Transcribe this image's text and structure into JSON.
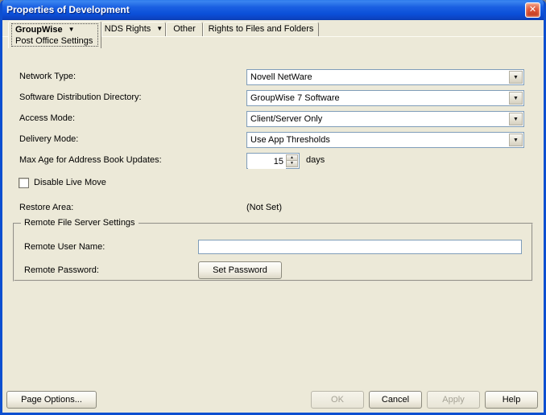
{
  "window": {
    "title": "Properties of Development"
  },
  "icons": {
    "close": "✕",
    "dropdown": "▼",
    "spin_up": "▲",
    "spin_down": "▼"
  },
  "tabs": [
    {
      "label": "GroupWise",
      "sublabel": "Post Office Settings"
    },
    {
      "label": "NDS Rights"
    },
    {
      "label": "Other"
    },
    {
      "label": "Rights to Files and Folders"
    }
  ],
  "fields": {
    "network_type": {
      "label": "Network Type:",
      "value": "Novell NetWare"
    },
    "software_distribution": {
      "label": "Software Distribution Directory:",
      "value": "GroupWise 7 Software"
    },
    "access_mode": {
      "label": "Access Mode:",
      "value": "Client/Server Only"
    },
    "delivery_mode": {
      "label": "Delivery Mode:",
      "value": "Use App Thresholds"
    },
    "max_age": {
      "label": "Max Age for Address Book Updates:",
      "value": "15",
      "suffix": "days"
    },
    "disable_live_move": {
      "label": "Disable Live Move",
      "checked": false
    },
    "restore_area": {
      "label": "Restore Area:",
      "value": "(Not Set)"
    }
  },
  "remote": {
    "group_title": "Remote File Server Settings",
    "user_label": "Remote User Name:",
    "user_value": "",
    "password_label": "Remote Password:",
    "set_password": "Set Password"
  },
  "footer": {
    "page_options": "Page Options...",
    "ok": "OK",
    "cancel": "Cancel",
    "apply": "Apply",
    "help": "Help"
  }
}
